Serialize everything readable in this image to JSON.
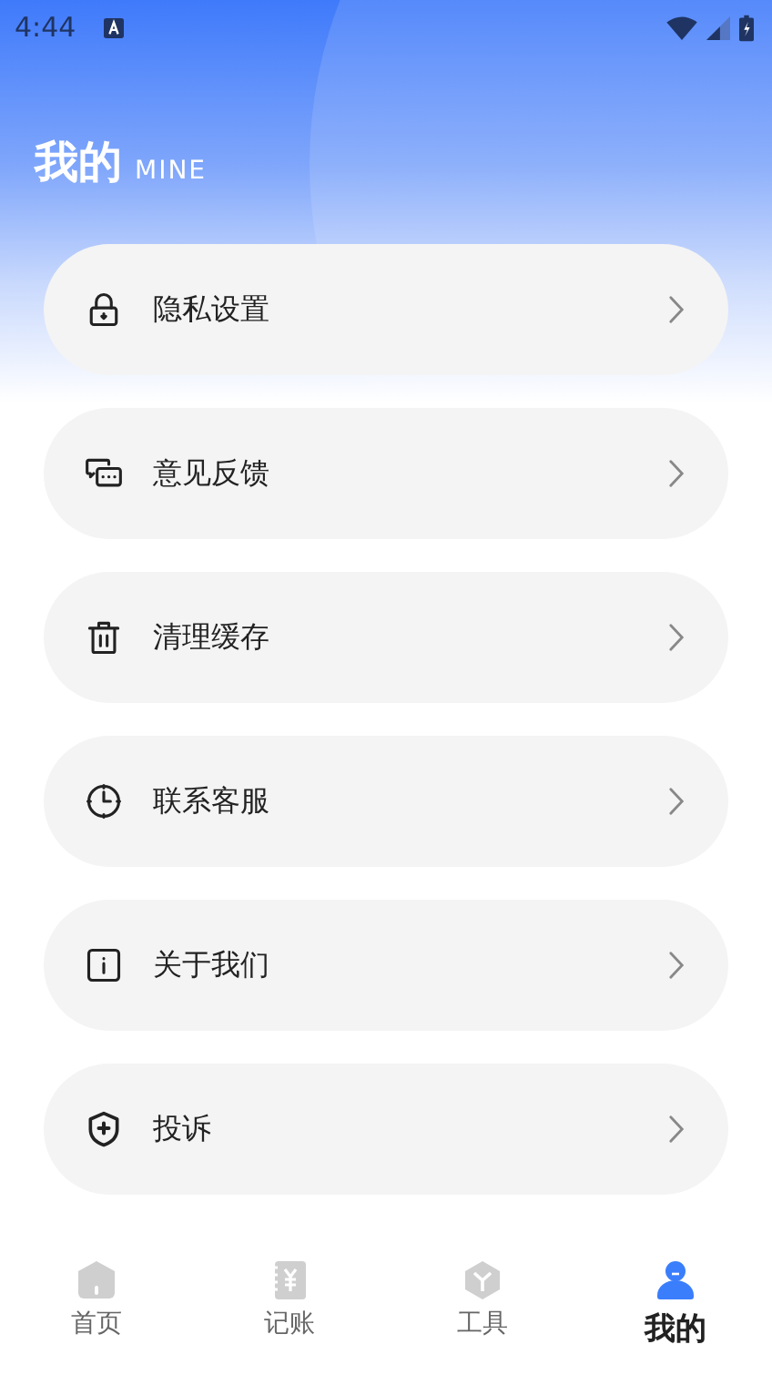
{
  "status_bar": {
    "time": "4:44"
  },
  "header": {
    "title": "我的",
    "subtitle": "MINE"
  },
  "menu": [
    {
      "label": "隐私设置"
    },
    {
      "label": "意见反馈"
    },
    {
      "label": "清理缓存"
    },
    {
      "label": "联系客服"
    },
    {
      "label": "关于我们"
    },
    {
      "label": "投诉"
    }
  ],
  "tab_bar": [
    {
      "label": "首页",
      "selected": false
    },
    {
      "label": "记账",
      "selected": false
    },
    {
      "label": "工具",
      "selected": false
    },
    {
      "label": "我的",
      "selected": true
    }
  ]
}
